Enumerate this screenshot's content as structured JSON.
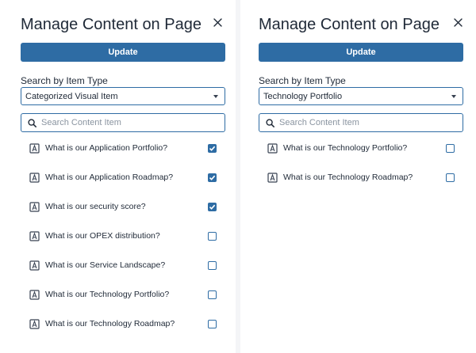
{
  "panels": [
    {
      "title": "Manage Content on Page",
      "update_label": "Update",
      "search_type_label": "Search by Item Type",
      "item_type_selected": "Categorized Visual Item",
      "search_placeholder": "Search Content Item",
      "items": [
        {
          "label": "What is our Application Portfolio?",
          "checked": true
        },
        {
          "label": "What is our Application Roadmap?",
          "checked": true
        },
        {
          "label": "What is our security score?",
          "checked": true
        },
        {
          "label": "What is our OPEX distribution?",
          "checked": false
        },
        {
          "label": "What is our Service Landscape?",
          "checked": false
        },
        {
          "label": "What is our Technology Portfolio?",
          "checked": false
        },
        {
          "label": "What is our Technology Roadmap?",
          "checked": false
        }
      ]
    },
    {
      "title": "Manage Content on Page",
      "update_label": "Update",
      "search_type_label": "Search by Item Type",
      "item_type_selected": "Technology Portfolio",
      "search_placeholder": "Search Content Item",
      "items": [
        {
          "label": "What is our Technology Portfolio?",
          "checked": false
        },
        {
          "label": "What is our Technology Roadmap?",
          "checked": false
        }
      ]
    }
  ],
  "icons": {
    "close": "close-icon",
    "search": "search-icon",
    "caret": "caret-down-icon",
    "item": "document-icon",
    "check": "check-icon"
  },
  "colors": {
    "accent": "#2e6ca4",
    "background": "#f4f5f7",
    "panel": "#ffffff",
    "text": "#1f2937"
  }
}
